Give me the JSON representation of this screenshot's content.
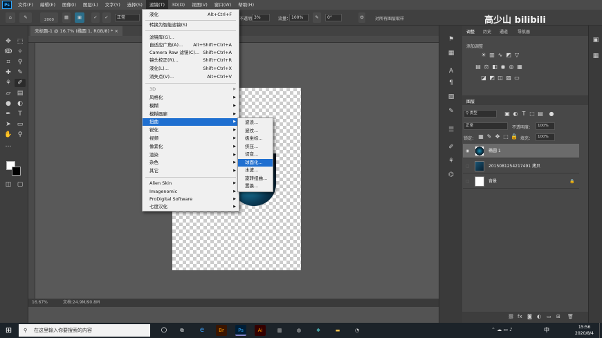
{
  "menubar": {
    "app_icon": "Ps",
    "items": [
      "文件(F)",
      "编辑(E)",
      "图像(I)",
      "图层(L)",
      "文字(Y)",
      "选择(S)",
      "滤镜(T)",
      "3D(D)",
      "视图(V)",
      "窗口(W)",
      "帮助(H)"
    ]
  },
  "options": {
    "size": "2000",
    "mode": "模式：",
    "mode_value": "正常",
    "opacity_label": "不透明度：",
    "opacity": "3%",
    "flow_label": "流量：",
    "flow": "100%",
    "angle": "0°",
    "sample_all": "对所有图层取样"
  },
  "document": {
    "tab_title": "未标题-1 @ 16.7% (椭圆 1, RGB/8) *",
    "zoom": "16.67%",
    "doc_info": "文档:24.9M/90.8M"
  },
  "filter_menu": {
    "items": [
      {
        "label": "液化",
        "shortcut": "Alt+Ctrl+F"
      },
      {
        "label": "转换为智能滤镜(S)"
      },
      {
        "label": "滤镜库(G)..."
      },
      {
        "label": "自适应广角(A)...",
        "shortcut": "Alt+Shift+Ctrl+A"
      },
      {
        "label": "Camera Raw 滤镜(C)...",
        "shortcut": "Shift+Ctrl+A"
      },
      {
        "label": "镜头校正(R)...",
        "shortcut": "Shift+Ctrl+R"
      },
      {
        "label": "液化(L)...",
        "shortcut": "Shift+Ctrl+X"
      },
      {
        "label": "消失点(V)...",
        "shortcut": "Alt+Ctrl+V"
      },
      {
        "label": "3D"
      },
      {
        "label": "风格化"
      },
      {
        "label": "模糊"
      },
      {
        "label": "模糊画廊"
      },
      {
        "label": "扭曲"
      },
      {
        "label": "锐化"
      },
      {
        "label": "视频"
      },
      {
        "label": "像素化"
      },
      {
        "label": "渲染"
      },
      {
        "label": "杂色"
      },
      {
        "label": "其它"
      },
      {
        "label": "Alien Skin"
      },
      {
        "label": "Imagenomic"
      },
      {
        "label": "ProDigital Software"
      },
      {
        "label": "七度汉化"
      }
    ]
  },
  "distort_submenu": {
    "items": [
      "波浪...",
      "波纹...",
      "极坐标...",
      "挤压...",
      "切变...",
      "球面化...",
      "水波...",
      "旋转扭曲...",
      "置换..."
    ]
  },
  "panels": {
    "top_tabs": [
      "调整",
      "历史",
      "通道",
      "导航器"
    ],
    "adjust_title": "添加调整",
    "layers_tab": "图层",
    "kind_filter": "类型",
    "blend_mode": "正常",
    "opacity_label": "不透明度：",
    "opacity": "100%",
    "lock_label": "锁定：",
    "fill_label": "填充：",
    "fill": "100%",
    "layers": [
      {
        "name": "椭圆 1",
        "selected": true
      },
      {
        "name": "20150812542174​91 拷贝",
        "selected": false
      },
      {
        "name": "背景",
        "selected": false,
        "locked": true
      }
    ]
  },
  "taskbar": {
    "search_placeholder": "在这里输入你要搜索的内容",
    "time": "15:56",
    "date": "2020/8/4",
    "ime": "中"
  },
  "watermark": "高少山 bilibili"
}
